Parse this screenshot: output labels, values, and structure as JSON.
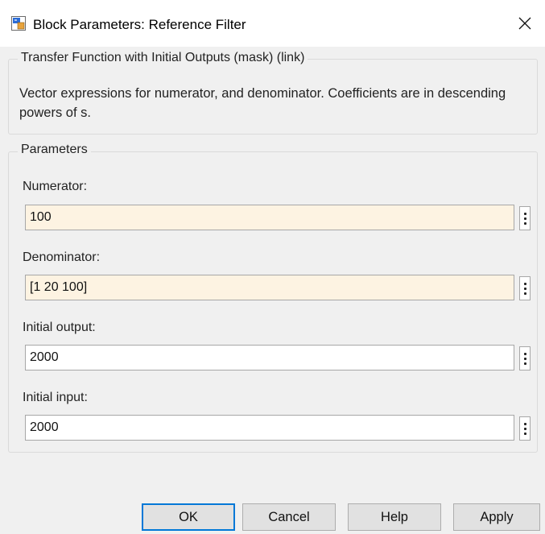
{
  "window": {
    "title": "Block Parameters: Reference Filter",
    "icon": "simulink-block-icon",
    "close_icon": "close-icon"
  },
  "mask": {
    "group_title": "Transfer Function with Initial Outputs (mask) (link)",
    "description": "Vector expressions for numerator, and denominator. Coefficients are in descending powers of s."
  },
  "parameters": {
    "group_title": "Parameters",
    "fields": [
      {
        "label": "Numerator:",
        "value": "100",
        "tinted": true
      },
      {
        "label": "Denominator:",
        "value": "[1 20 100]",
        "tinted": true
      },
      {
        "label": "Initial output:",
        "value": "2000",
        "tinted": false
      },
      {
        "label": "Initial input:",
        "value": "2000",
        "tinted": false
      }
    ],
    "menu_icon": "vertical-ellipsis-icon"
  },
  "buttons": {
    "ok": "OK",
    "cancel": "Cancel",
    "help": "Help",
    "apply": "Apply"
  },
  "colors": {
    "tinted_field": "#fdf3e2",
    "default_button_border": "#0078d7",
    "window_background": "#f0f0f0"
  }
}
